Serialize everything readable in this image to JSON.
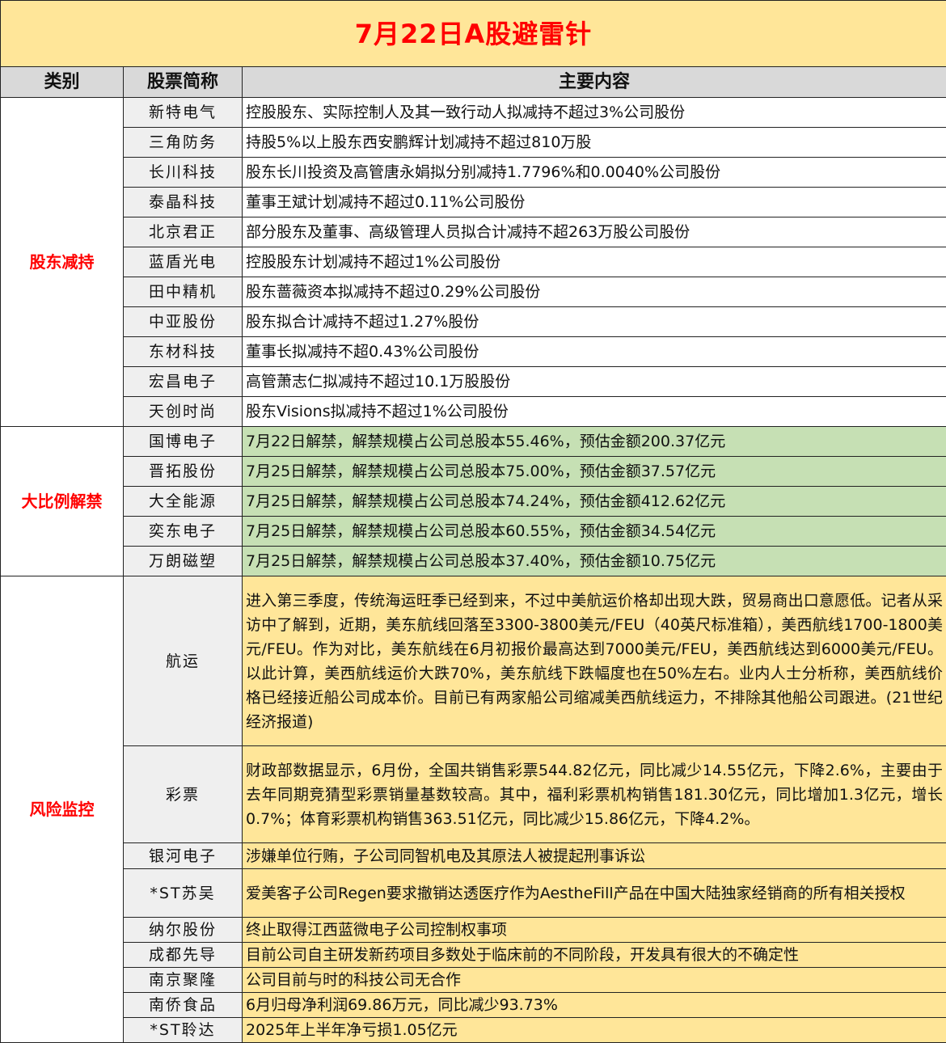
{
  "title": "7月22日A股避雷针",
  "headers": [
    "类别",
    "股票简称",
    "主要内容"
  ],
  "sections": [
    {
      "category": "股东减持",
      "rows": [
        {
          "name": "新特电气",
          "content": "控股股东、实际控制人及其一致行动人拟减持不超过3%公司股份"
        },
        {
          "name": "三角防务",
          "content": "持股5%以上股东西安鹏辉计划减持不超过810万股"
        },
        {
          "name": "长川科技",
          "content": "股东长川投资及高管唐永娟拟分别减持1.7796%和0.0040%公司股份"
        },
        {
          "name": "泰晶科技",
          "content": "董事王斌计划减持不超过0.11%公司股份"
        },
        {
          "name": "北京君正",
          "content": "部分股东及董事、高级管理人员拟合计减持不超263万股公司股份"
        },
        {
          "name": "蓝盾光电",
          "content": "控股股东计划减持不超过1%公司股份"
        },
        {
          "name": "田中精机",
          "content": "股东蔷薇资本拟减持不超过0.29%公司股份"
        },
        {
          "name": "中亚股份",
          "content": "股东拟合计减持不超过1.27%股份"
        },
        {
          "name": "东材科技",
          "content": "董事长拟减持不超0.43%公司股份"
        },
        {
          "name": "宏昌电子",
          "content": "高管萧志仁拟减持不超过10.1万股股份"
        },
        {
          "name": "天创时尚",
          "content": "股东Visions拟减持不超过1%公司股份"
        }
      ]
    },
    {
      "category": "大比例解禁",
      "rows": [
        {
          "name": "国博电子",
          "content": "7月22日解禁，解禁规模占公司总股本55.46%，预估金额200.37亿元"
        },
        {
          "name": "晋拓股份",
          "content": "7月25日解禁，解禁规模占公司总股本75.00%，预估金额37.57亿元"
        },
        {
          "name": "大全能源",
          "content": "7月25日解禁，解禁规模占公司总股本74.24%，预估金额412.62亿元"
        },
        {
          "name": "奕东电子",
          "content": "7月25日解禁，解禁规模占公司总股本60.55%，预估金额34.54亿元"
        },
        {
          "name": "万朗磁塑",
          "content": "7月25日解禁，解禁规模占公司总股本37.40%，预估金额10.75亿元"
        }
      ]
    },
    {
      "category": "风险监控",
      "rows": [
        {
          "name": "航运",
          "content": "进入第三季度，传统海运旺季已经到来，不过中美航运价格却出现大跌，贸易商出口意愿低。记者从采访中了解到，近期，美东航线回落至3300-3800美元/FEU（40英尺标准箱），美西航线1700-1800美元/FEU。作为对比，美东航线在6月初报价最高达到7000美元/FEU，美西航线达到6000美元/FEU。以此计算，美西航线运价大跌70%，美东航线下跌幅度也在50%左右。业内人士分析称，美西航线价格已经接近船公司成本价。目前已有两家船公司缩减美西航线运力，不排除其他船公司跟进。(21世纪经济报道)"
        },
        {
          "name": "彩票",
          "content": "财政部数据显示，6月份，全国共销售彩票544.82亿元，同比减少14.55亿元，下降2.6%，主要由于去年同期竞猜型彩票销量基数较高。其中，福利彩票机构销售181.30亿元，同比增加1.3亿元，增长0.7%；体育彩票机构销售363.51亿元，同比减少15.86亿元，下降4.2%。"
        },
        {
          "name": "银河电子",
          "content": "涉嫌单位行贿，子公司同智机电及其原法人被提起刑事诉讼"
        },
        {
          "name": "*ST苏吴",
          "content": "爱美客子公司Regen要求撤销达透医疗作为AestheFill产品在中国大陆独家经销商的所有相关授权"
        },
        {
          "name": "纳尔股份",
          "content": "终止取得江西蓝微电子公司控制权事项"
        },
        {
          "name": "成都先导",
          "content": "目前公司自主研发新药项目多数处于临床前的不同阶段，开发具有很大的不确定性"
        },
        {
          "name": "南京聚隆",
          "content": "公司目前与时的科技公司无合作"
        },
        {
          "name": "南侨食品",
          "content": "6月归母净利润69.86万元，同比减少93.73%"
        },
        {
          "name": "*ST聆达",
          "content": "2025年上半年净亏损1.05亿元"
        }
      ]
    }
  ]
}
